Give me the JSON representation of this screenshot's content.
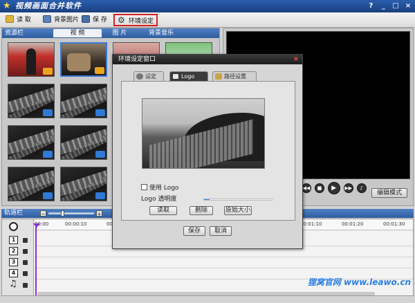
{
  "app": {
    "title": "视频画面合并软件",
    "window_buttons": [
      "?",
      "_",
      "□",
      "×"
    ]
  },
  "toolbar": {
    "open_label": "读 取",
    "bg_image_label": "背景图片",
    "save_label": "保 存",
    "env_settings_label": "环境设定"
  },
  "resource_panel": {
    "title": "资源栏",
    "tabs": [
      "视 频",
      "图 片",
      "背景音乐"
    ],
    "active_tab": 0
  },
  "preview": {
    "controls": [
      "◀◀",
      "■",
      "▶",
      "▶▶",
      "♪"
    ],
    "edit_mode_label": "编辑模式"
  },
  "timeline": {
    "title": "轨道栏",
    "zoom_minus": "−",
    "zoom_plus": "+",
    "ticks": [
      "00:00",
      "00:00:10",
      "00:00:20",
      "00:01:10",
      "00:01:20",
      "00:01:30"
    ],
    "tracks": [
      "1",
      "2",
      "3",
      "4"
    ]
  },
  "dialog": {
    "title": "环境设定窗口",
    "close": "×",
    "tabs": [
      "设定",
      "Logo",
      "路径设置"
    ],
    "active_tab": 1,
    "use_logo_label": "使用 Logo",
    "opacity_label": "Logo 透明度",
    "opacity_value": 0.05,
    "read_label": "读取",
    "delete_label": "删除",
    "original_size_label": "原始大小",
    "save_label": "保存",
    "cancel_label": "取消"
  },
  "watermark": "狸窝官网 www.leawo.cn",
  "colors": {
    "title_bar": "#1a3f7e",
    "highlight_red": "#d61e1e",
    "playhead": "#8b2fd0",
    "watermark": "#2a7fe0"
  }
}
